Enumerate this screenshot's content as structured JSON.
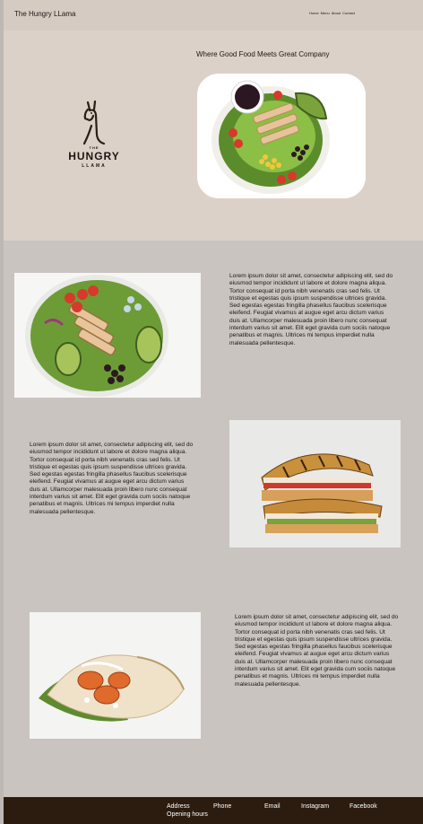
{
  "header": {
    "brand": "The Hungry LLama",
    "nav": [
      "Home",
      "Menu",
      "About",
      "Contact"
    ]
  },
  "hero": {
    "tagline": "Where Good Food Meets Great Company",
    "logo": {
      "line1": "THE",
      "line2": "HUNGRY",
      "line3": "LLAMA"
    }
  },
  "sections": [
    {
      "text": "Lorem ipsum dolor sit amet, consectetur adipiscing elit, sed do eiusmod tempor incididunt ut labore et dolore magna aliqua. Tortor consequat id porta nibh venenatis cras sed felis. Ut tristique et egestas quis ipsum suspendisse ultrices gravida. Sed egestas egestas fringilla phasellus faucibus scelerisque eleifend. Feugiat vivamus at augue eget arcu dictum varius duis at. Ullamcorper malesuada proin libero nunc consequat interdum varius sit amet. Elit eget gravida cum sociis natoque penatibus et magnis. Ultrices mi tempus imperdiet nulla malesuada pellentesque."
    },
    {
      "text": "Lorem ipsum dolor sit amet, consectetur adipiscing elit, sed do eiusmod tempor incididunt ut labore et dolore magna aliqua. Tortor consequat id porta nibh venenatis cras sed felis. Ut tristique et egestas quis ipsum suspendisse ultrices gravida. Sed egestas egestas fringilla phasellus faucibus scelerisque eleifend. Feugiat vivamus at augue eget arcu dictum varius duis at. Ullamcorper malesuada proin libero nunc consequat interdum varius sit amet. Elit eget gravida cum sociis natoque penatibus et magnis. Ultrices mi tempus imperdiet nulla malesuada pellentesque."
    },
    {
      "text": "Lorem ipsum dolor sit amet, consectetur adipiscing elit, sed do eiusmod tempor incididunt ut labore et dolore magna aliqua. Tortor consequat id porta nibh venenatis cras sed felis. Ut tristique et egestas quis ipsum suspendisse ultrices gravida. Sed egestas egestas fringilla phasellus faucibus scelerisque eleifend. Feugiat vivamus at augue eget arcu dictum varius duis at. Ullamcorper malesuada proin libero nunc consequat interdum varius sit amet. Elit eget gravida cum sociis natoque penatibus et magnis. Ultrices mi tempus imperdiet nulla malesuada pellentesque."
    }
  ],
  "footer": {
    "address": "Address",
    "phone": "Phone",
    "email": "Email",
    "instagram": "Instagram",
    "facebook": "Facebook",
    "hours": "Opening hours"
  },
  "colors": {
    "page_bg": "#c9c4c0",
    "header_bg": "#d6cbc3",
    "hero_bg": "#dcd1c8",
    "footer_bg": "#2b1c0f",
    "brand_brown": "#2a1d12"
  }
}
